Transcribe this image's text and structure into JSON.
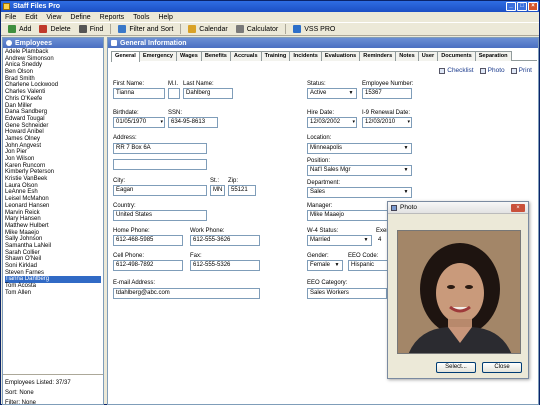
{
  "app": {
    "title": "Staff Files Pro"
  },
  "menu": [
    "File",
    "Edit",
    "View",
    "Define",
    "Reports",
    "Tools",
    "Help"
  ],
  "toolbar": [
    {
      "label": "Add",
      "icon": "add-user-icon",
      "color": "#3f8f3f"
    },
    {
      "label": "Delete",
      "icon": "delete-user-icon",
      "color": "#c0392b"
    },
    {
      "label": "Find",
      "icon": "binoculars-icon",
      "color": "#555555"
    },
    {
      "label": "Filter and Sort",
      "icon": "filter-icon",
      "color": "#3a78c8"
    },
    {
      "label": "Calendar",
      "icon": "calendar-icon",
      "color": "#d9a227"
    },
    {
      "label": "Calculator",
      "icon": "calculator-icon",
      "color": "#7a7a7a"
    },
    {
      "label": "VSS PRO",
      "icon": "vss-icon",
      "color": "#2d6fc9"
    }
  ],
  "employees_panel": {
    "title": "Employees",
    "items": [
      "Adele Plamback",
      "Andrew Simonson",
      "Anica Sneddy",
      "Ben Olson",
      "Brad Smith",
      "Charlene Lockwood",
      "Charles Valenti",
      "Chris O'Keefe",
      "Dan Miller",
      "Dana Sandberg",
      "Edward Tougal",
      "Gene Schneider",
      "Howard Anibel",
      "James Olney",
      "John Angvest",
      "Jon Pier",
      "Jon Wilson",
      "Karen Runcorn",
      "Kimberly Peterson",
      "Kristie VanBeek",
      "Laura Olson",
      "LeAnne Esh",
      "Leisel McMahon",
      "Leonard Hansen",
      "Marvin Reick",
      "Mary Hansen",
      "Matthew Hulbert",
      "Mike Maaejo",
      "Sally Johnson",
      "Samantha LaNeil",
      "Sarah Collier",
      "Shawn O'Neil",
      "Soni Kirklad",
      "Steven Farnes",
      "Tianna Dahlberg",
      "Tom Acosta",
      "Tom Allen"
    ],
    "selected": "Tianna Dahlberg",
    "footer": {
      "listed": "Employees Listed: 37/37",
      "sort": "Sort: None",
      "filter": "Filter: None"
    }
  },
  "info_panel": {
    "title": "General Information",
    "tabs": [
      "General",
      "Emergency",
      "Wages",
      "Benefits",
      "Accruals",
      "Training",
      "Incidents",
      "Evaluations",
      "Reminders",
      "Notes",
      "User",
      "Documents",
      "Separation"
    ],
    "active_tab": "General",
    "links": [
      {
        "label": "Checklist",
        "icon": "checklist-icon"
      },
      {
        "label": "Photo",
        "icon": "camera-icon"
      },
      {
        "label": "Print",
        "icon": "printer-icon"
      }
    ],
    "fields": {
      "first_name": {
        "label": "First Name:",
        "value": "Tianna"
      },
      "mi": {
        "label": "M.I.",
        "value": ""
      },
      "last_name": {
        "label": "Last Name:",
        "value": "Dahlberg"
      },
      "birthdate": {
        "label": "Birthdate:",
        "value": "01/05/1970"
      },
      "ssn": {
        "label": "SSN:",
        "value": "634-95-8613"
      },
      "address": {
        "label": "Address:",
        "value": "RR 7 Box 6A",
        "value2": ""
      },
      "city": {
        "label": "City:",
        "value": "Eagan"
      },
      "state": {
        "label": "St.:",
        "value": "MN"
      },
      "zip": {
        "label": "Zip:",
        "value": "55121"
      },
      "country": {
        "label": "Country:",
        "value": "United States"
      },
      "home_phone": {
        "label": "Home Phone:",
        "value": "612-468-5985"
      },
      "work_phone": {
        "label": "Work Phone:",
        "value": "612-555-3626"
      },
      "cell_phone": {
        "label": "Cell Phone:",
        "value": "612-498-7892"
      },
      "fax": {
        "label": "Fax:",
        "value": "612-555-5326"
      },
      "email": {
        "label": "E-mail Address:",
        "value": "tdahlberg@abc.com"
      },
      "status": {
        "label": "Status:",
        "value": "Active"
      },
      "employee_number": {
        "label": "Employee Number:",
        "value": "15367"
      },
      "hire_date": {
        "label": "Hire Date:",
        "value": "12/03/2002"
      },
      "i9_date": {
        "label": "I-9 Renewal Date:",
        "value": "12/03/2010"
      },
      "location": {
        "label": "Location:",
        "value": "Minneapolis"
      },
      "position": {
        "label": "Position:",
        "value": "Nat'l Sales Mgr"
      },
      "department": {
        "label": "Department:",
        "value": "Sales"
      },
      "manager": {
        "label": "Manager:",
        "value": "Mike Maaejo"
      },
      "w4_status": {
        "label": "W-4 Status:",
        "value": "Married"
      },
      "exemptions": {
        "label": "Exem",
        "value": "4"
      },
      "gender": {
        "label": "Gender:",
        "value": "Female"
      },
      "eeo_code": {
        "label": "EEO Code:",
        "value": "Hispanic"
      },
      "eeo_category": {
        "label": "EEO Category:",
        "value": "Sales Workers"
      }
    }
  },
  "photo_dialog": {
    "title": "Photo",
    "select_label": "Select...",
    "close_label": "Close"
  }
}
